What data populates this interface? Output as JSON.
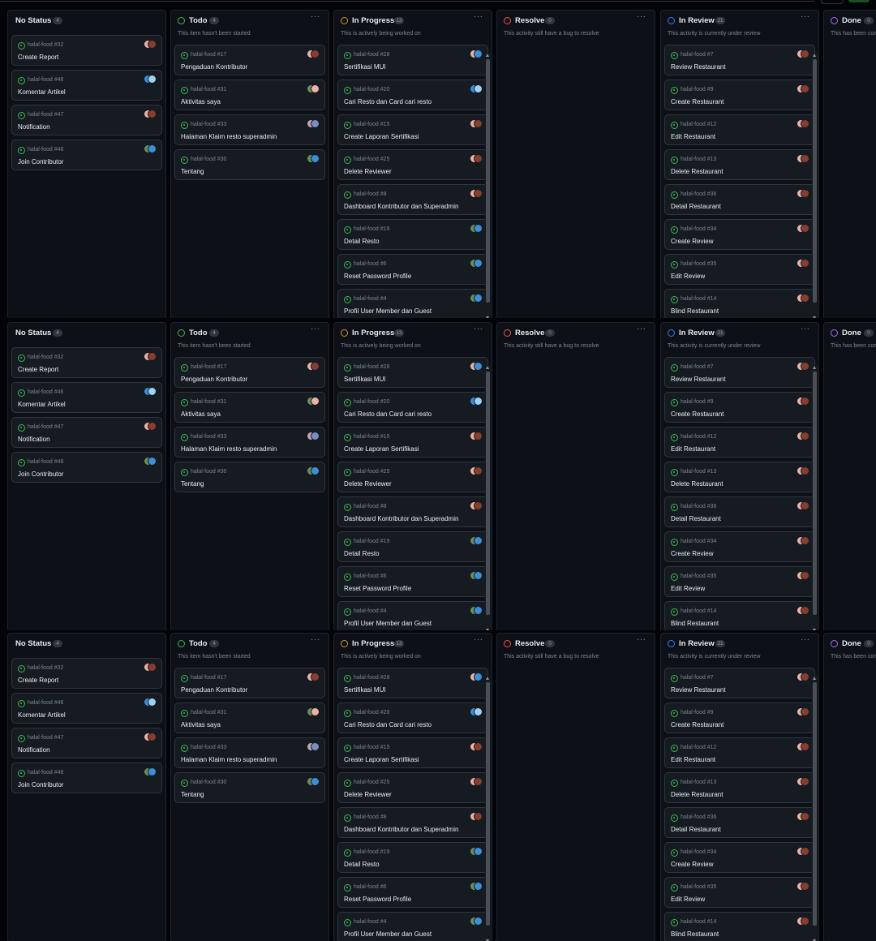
{
  "issue_prefix": "halal-food #",
  "boards_count": 3,
  "columns": [
    {
      "title": "No Status",
      "count": "4",
      "description": "",
      "status_color": "#7d8590",
      "icon": "no-status-icon",
      "cards": [
        {
          "num": "32",
          "title": "Create Report",
          "avatar": [
            "#e8b4a8",
            "#8a3d2c"
          ]
        },
        {
          "num": "46",
          "title": "Komentar Artikel",
          "avatar": [
            "#3b8fd8",
            "#9ad1f5"
          ]
        },
        {
          "num": "47",
          "title": "Notification",
          "avatar": [
            "#e8b4a8",
            "#8a3d2c"
          ]
        },
        {
          "num": "48",
          "title": "Join Contributor",
          "avatar": [
            "#6a8f5a",
            "#3b8fd8"
          ]
        }
      ]
    },
    {
      "title": "Todo",
      "count": "4",
      "description": "This item hasn't been started",
      "status_color": "#3fb950",
      "icon": "todo-status-icon",
      "cards": [
        {
          "num": "17",
          "title": "Pengaduan Kontributor",
          "avatar": [
            "#e8b4a8",
            "#8a3d2c"
          ]
        },
        {
          "num": "31",
          "title": "Aktivitas saya",
          "avatar": [
            "#6a8f5a",
            "#e8b4a8"
          ]
        },
        {
          "num": "33",
          "title": "Halaman Klaim resto superadmin",
          "avatar": [
            "#c9a3b5",
            "#7a8fbf"
          ]
        },
        {
          "num": "30",
          "title": "Tentang",
          "avatar": [
            "#6a8f5a",
            "#3b8fd8"
          ]
        }
      ]
    },
    {
      "title": "In Progress",
      "count": "13",
      "description": "This is actively being worked on",
      "status_color": "#d29922",
      "icon": "in-progress-status-icon",
      "cards": [
        {
          "num": "28",
          "title": "Sertifikasi MUI",
          "avatar": [
            "#e8b4a8",
            "#3b8fd8"
          ]
        },
        {
          "num": "20",
          "title": "Cari Resto dan Card cari resto",
          "avatar": [
            "#3b8fd8",
            "#9ad1f5"
          ]
        },
        {
          "num": "15",
          "title": "Create Laporan Sertifikasi",
          "avatar": [
            "#e8b4a8",
            "#8a3d2c"
          ]
        },
        {
          "num": "25",
          "title": "Delete Reviewer",
          "avatar": [
            "#e8b4a8",
            "#8a3d2c"
          ]
        },
        {
          "num": "8",
          "title": "Dashboard Kontributor dan Superadmin",
          "avatar": [
            "#e8b4a8",
            "#8a3d2c"
          ]
        },
        {
          "num": "19",
          "title": "Detail Resto",
          "avatar": [
            "#6a8f5a",
            "#3b8fd8"
          ]
        },
        {
          "num": "6",
          "title": "Reset Password Profile",
          "avatar": [
            "#6a8f5a",
            "#3b8fd8"
          ]
        },
        {
          "num": "4",
          "title": "Profil User Member dan Guest",
          "avatar": [
            "#6a8f5a",
            "#3b8fd8"
          ]
        }
      ]
    },
    {
      "title": "Resolve",
      "count": "0",
      "description": "This activity still have a bug to resolve",
      "status_color": "#f85149",
      "icon": "resolve-status-icon",
      "cards": []
    },
    {
      "title": "In Review",
      "count": "21",
      "description": "This activity is currently under review",
      "status_color": "#2f81f7",
      "icon": "in-review-status-icon",
      "cards": [
        {
          "num": "7",
          "title": "Review Restaurant",
          "avatar": [
            "#e8b4a8",
            "#8a3d2c"
          ]
        },
        {
          "num": "9",
          "title": "Create Restaurant",
          "avatar": [
            "#e8b4a8",
            "#8a3d2c"
          ]
        },
        {
          "num": "12",
          "title": "Edit Restaurant",
          "avatar": [
            "#e8b4a8",
            "#8a3d2c"
          ]
        },
        {
          "num": "13",
          "title": "Delete Restaurant",
          "avatar": [
            "#e8b4a8",
            "#8a3d2c"
          ]
        },
        {
          "num": "36",
          "title": "Detail Restaurant",
          "avatar": [
            "#e8b4a8",
            "#8a3d2c"
          ]
        },
        {
          "num": "34",
          "title": "Create Review",
          "avatar": [
            "#e8b4a8",
            "#8a3d2c"
          ]
        },
        {
          "num": "35",
          "title": "Edit Review",
          "avatar": [
            "#e8b4a8",
            "#8a3d2c"
          ]
        },
        {
          "num": "14",
          "title": "Blind Restaurant",
          "avatar": [
            "#e8b4a8",
            "#8a3d2c"
          ]
        }
      ]
    },
    {
      "title": "Done",
      "count": "0",
      "description": "This has been completed",
      "status_color": "#a371f7",
      "icon": "done-status-icon",
      "cards": []
    }
  ]
}
